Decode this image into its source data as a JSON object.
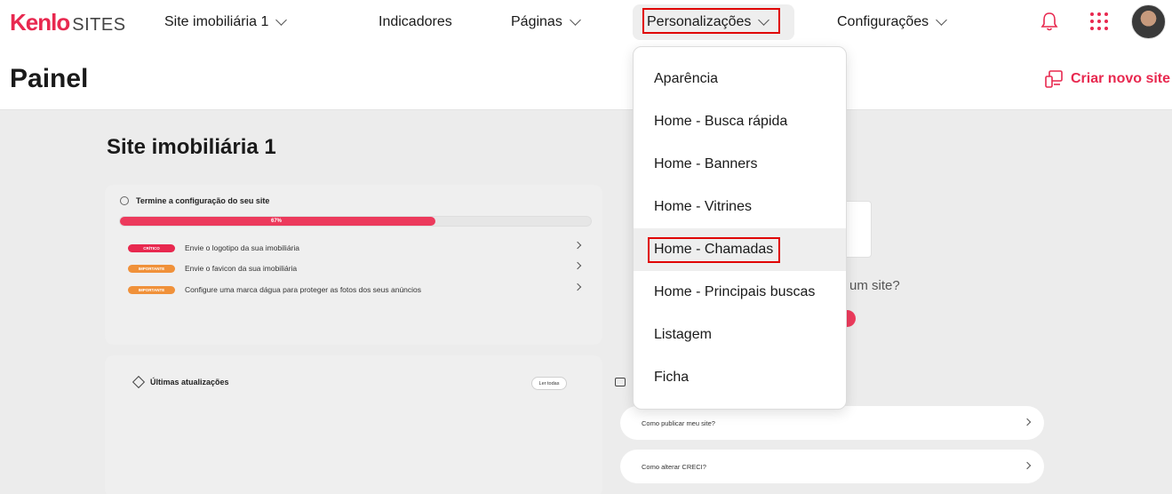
{
  "topnav": {
    "logo_brand": "Kenlo",
    "logo_product": "SITES",
    "site_selector": "Site imobiliária 1",
    "indicators": "Indicadores",
    "pages": "Páginas",
    "customizations": "Personalizações",
    "settings": "Configurações"
  },
  "header": {
    "title": "Painel",
    "create_site": "Criar novo site"
  },
  "main": {
    "site_title": "Site imobiliária 1",
    "setup": {
      "title": "Termine a configuração do seu site",
      "progress": 67,
      "progress_label": "67%",
      "tasks": [
        {
          "badge": "CRÍTICO",
          "badge_color": "#e8284f",
          "text": "Envie o logotipo da sua imobiliária"
        },
        {
          "badge": "IMPORTANTE",
          "badge_color": "#f0913a",
          "text": "Envie o favicon da sua imobiliária"
        },
        {
          "badge": "IMPORTANTE",
          "badge_color": "#f0913a",
          "text": "Configure uma marca dágua para proteger as fotos dos seus anúncios"
        }
      ]
    },
    "partial_text": "um site?",
    "updates": {
      "title": "Últimas atualizações",
      "read_all": "Ler todas"
    },
    "faq": [
      "Como publicar meu site?",
      "Como alterar CRECI?"
    ]
  },
  "dropdown": {
    "items": [
      "Aparência",
      "Home - Busca rápida",
      "Home - Banners",
      "Home - Vitrines",
      "Home - Chamadas",
      "Home - Principais buscas",
      "Listagem",
      "Ficha"
    ],
    "active_index": 4
  },
  "colors": {
    "accent": "#e8284f",
    "warning": "#f0913a",
    "highlight_box": "#e00000"
  }
}
